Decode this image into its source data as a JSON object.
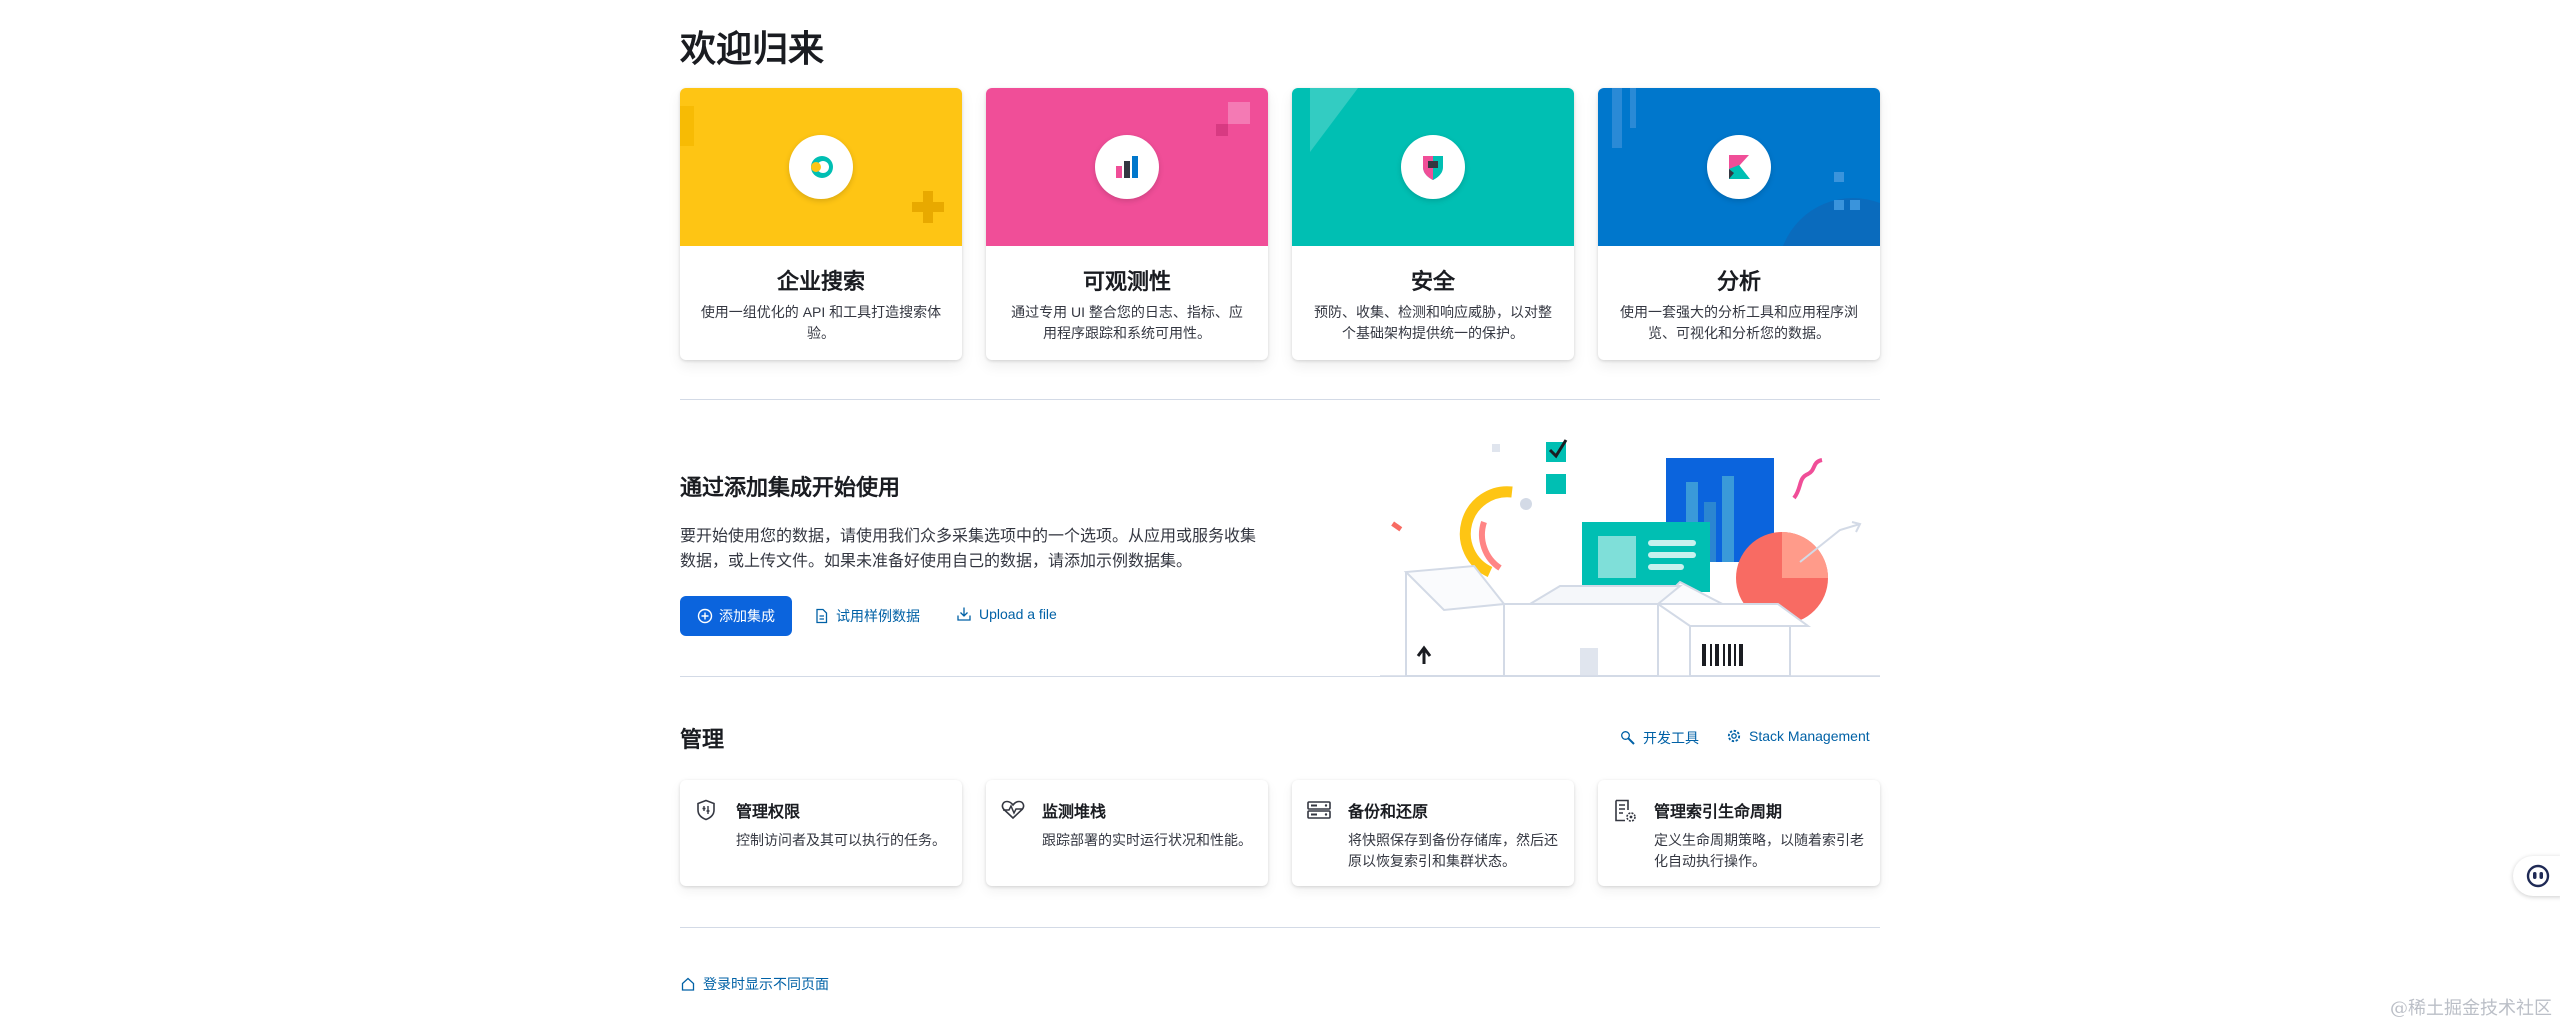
{
  "page": {
    "title": "欢迎归来"
  },
  "solutions": [
    {
      "title": "企业搜索",
      "description": "使用一组优化的 API 和工具打造搜索体验。",
      "color": "#fec514"
    },
    {
      "title": "可观测性",
      "description": "通过专用 UI 整合您的日志、指标、应用程序跟踪和系统可用性。",
      "color": "#f04e98"
    },
    {
      "title": "安全",
      "description": "预防、收集、检测和响应威胁，以对整个基础架构提供统一的保护。",
      "color": "#00bfb3"
    },
    {
      "title": "分析",
      "description": "使用一套强大的分析工具和应用程序浏览、可视化和分析您的数据。",
      "color": "#0077cc"
    }
  ],
  "intro": {
    "title": "通过添加集成开始使用",
    "description": "要开始使用您的数据，请使用我们众多采集选项中的一个选项。从应用或服务收集数据，或上传文件。如果未准备好使用自己的数据，请添加示例数据集。",
    "add_integration": "添加集成",
    "try_sample": "试用样例数据",
    "upload": "Upload a file"
  },
  "management": {
    "title": "管理",
    "dev_tools": "开发工具",
    "stack_management": "Stack Management",
    "cards": [
      {
        "title": "管理权限",
        "description": "控制访问者及其可以执行的任务。",
        "icon": "shield-icon"
      },
      {
        "title": "监测堆栈",
        "description": "跟踪部署的实时运行状况和性能。",
        "icon": "heartbeat-icon"
      },
      {
        "title": "备份和还原",
        "description": "将快照保存到备份存储库，然后还原以恢复索引和集群状态。",
        "icon": "storage-icon"
      },
      {
        "title": "管理索引生命周期",
        "description": "定义生命周期策略，以随着索引老化自动执行操作。",
        "icon": "document-gear-icon"
      }
    ]
  },
  "footer": {
    "link": "登录时显示不同页面"
  },
  "watermark": "@稀土掘金技术社区",
  "colors": {
    "primary": "#0b64dd",
    "link": "#0061a6"
  }
}
